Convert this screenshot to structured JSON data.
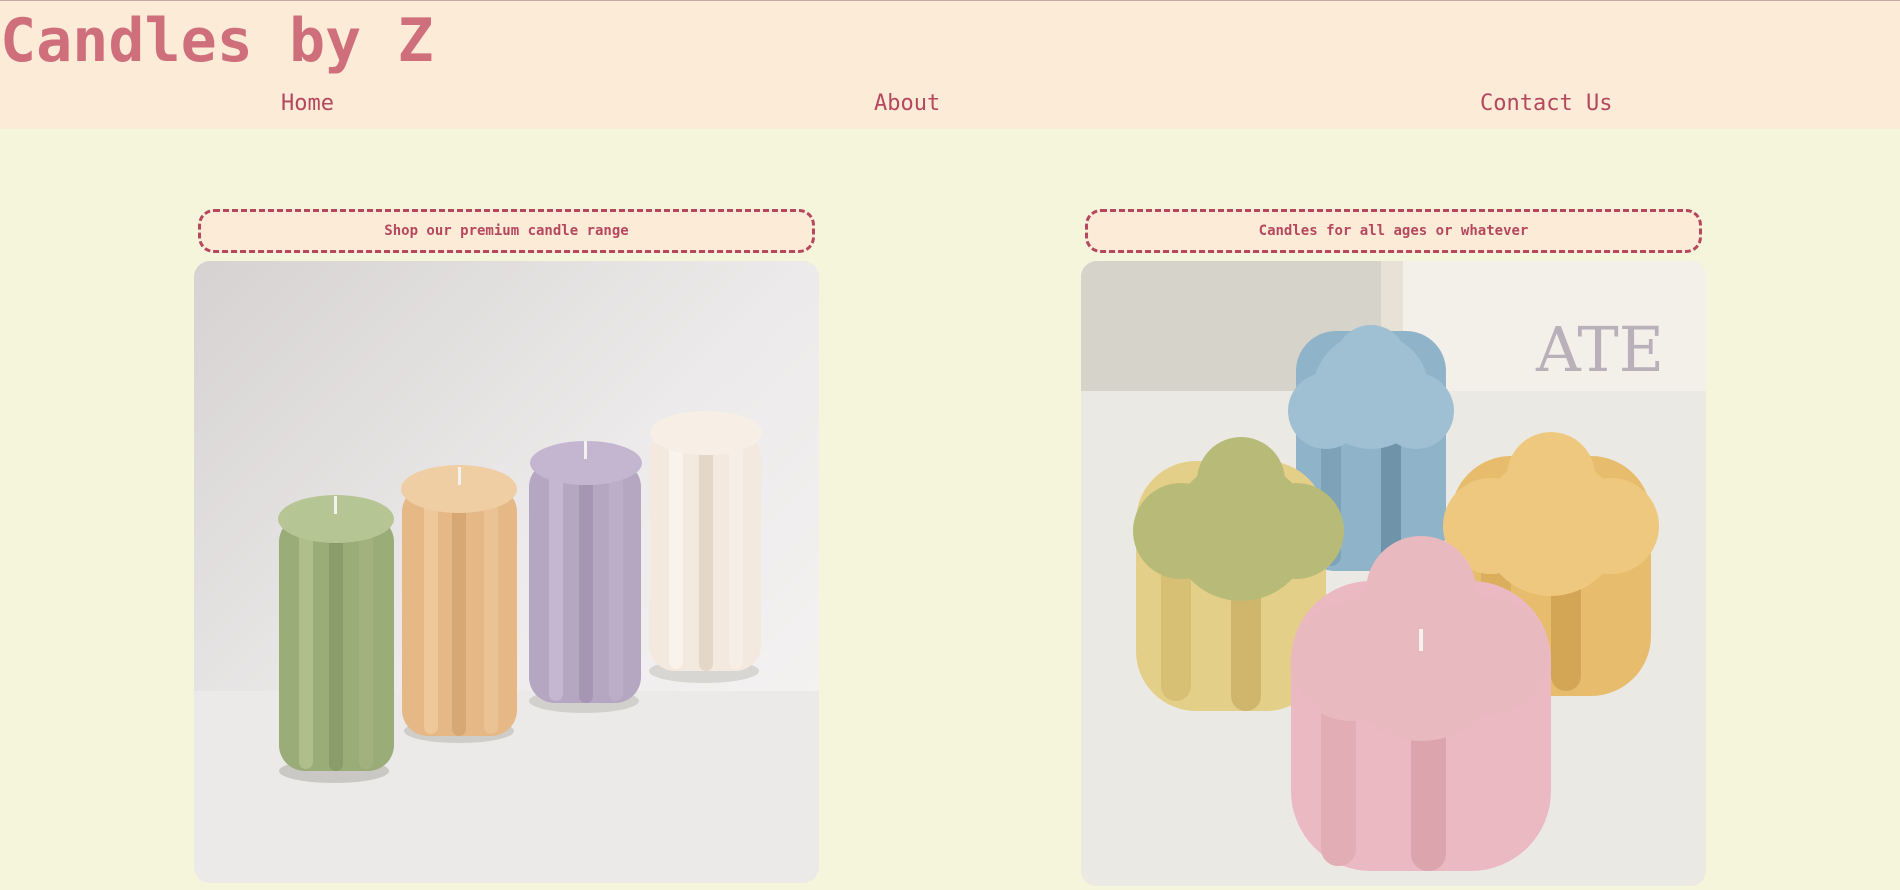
{
  "header": {
    "title": "Candles by Z",
    "nav": {
      "home": "Home",
      "about": "About",
      "contact": "Contact Us"
    }
  },
  "cards": [
    {
      "label": "Shop our premium candle range",
      "image": "four flower pillar candles in green, peach, lilac and cream"
    },
    {
      "label": "Candles for all ages or whatever",
      "image": "flower shaped candles in blue, green, yellow and pink",
      "image_text": "ATE"
    }
  ],
  "colors": {
    "header_bg": "#fbebd7",
    "page_bg": "#f5f5dc",
    "title": "#cf6f7c",
    "nav": "#b5475e",
    "label_border": "#b5475e"
  }
}
